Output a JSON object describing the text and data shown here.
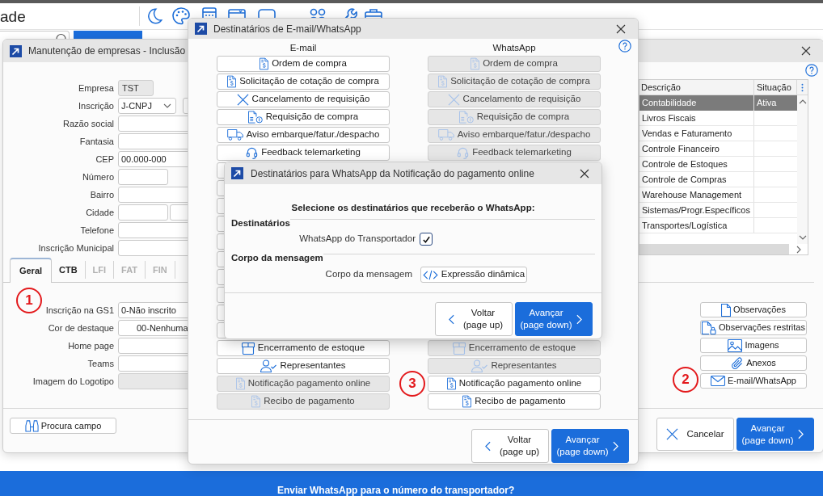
{
  "app": {
    "title": "ade",
    "notification": "Enviar WhatsApp para o número do transportador?"
  },
  "company_window": {
    "title": "Manutenção de empresas - Inclusão",
    "fields": [
      {
        "label": "Empresa",
        "kind": "readonly",
        "value": "TST"
      },
      {
        "label": "Inscrição",
        "kind": "select_pair",
        "value": "J-CNPJ"
      },
      {
        "label": "Razão social",
        "kind": "text"
      },
      {
        "label": "Fantasia",
        "kind": "text"
      },
      {
        "label": "CEP",
        "kind": "text",
        "value": "00.000-000"
      },
      {
        "label": "Número",
        "kind": "short"
      },
      {
        "label": "Bairro",
        "kind": "text"
      },
      {
        "label": "Cidade",
        "kind": "pair"
      },
      {
        "label": "Telefone",
        "kind": "text"
      },
      {
        "label": "Inscrição Municipal",
        "kind": "text"
      }
    ],
    "tabs": [
      {
        "label": "Geral",
        "selected": true,
        "disabled": false
      },
      {
        "label": "CTB",
        "selected": false,
        "disabled": false
      },
      {
        "label": "LFI",
        "selected": false,
        "disabled": true
      },
      {
        "label": "FAT",
        "selected": false,
        "disabled": true
      },
      {
        "label": "FIN",
        "selected": false,
        "disabled": true
      }
    ],
    "tab_annotation": "1",
    "tab_fields": [
      {
        "label": "Inscrição na GS1",
        "kind": "text",
        "value": "0-Não inscrito"
      },
      {
        "label": "Cor de destaque",
        "kind": "color",
        "value": "00-Nenhuma"
      },
      {
        "label": "Home page",
        "kind": "text"
      },
      {
        "label": "Teams",
        "kind": "text"
      },
      {
        "label": "Imagem do Logotipo",
        "kind": "readonly_wide"
      }
    ],
    "search_button": "Procura campo",
    "modules_table": {
      "columns": [
        "Descrição",
        "Situação"
      ],
      "rows": [
        {
          "cells": [
            "Contabilidade",
            "Ativa"
          ],
          "selected": true
        },
        {
          "cells": [
            "Livros Fiscais"
          ],
          "selected": false
        },
        {
          "cells": [
            "Vendas e Faturamento"
          ],
          "selected": false
        },
        {
          "cells": [
            "Controle Financeiro"
          ],
          "selected": false
        },
        {
          "cells": [
            "Controle de Estoques"
          ],
          "selected": false
        },
        {
          "cells": [
            "Controle de Compras"
          ],
          "selected": false
        },
        {
          "cells": [
            "Warehouse Management"
          ],
          "selected": false
        },
        {
          "cells": [
            "Sistemas/Progr.Específicos"
          ],
          "selected": false
        },
        {
          "cells": [
            "Transportes/Logística"
          ],
          "selected": false
        }
      ]
    },
    "side_buttons": [
      {
        "kind": "notes",
        "label": "Observações"
      },
      {
        "kind": "restricted_notes",
        "label": "Observações restritas"
      },
      {
        "kind": "images",
        "label": "Imagens"
      },
      {
        "kind": "attachments",
        "label": "Anexos"
      },
      {
        "kind": "email",
        "label": "E-mail/WhatsApp"
      }
    ],
    "side_annotation": "2",
    "cancel_button": "Cancelar",
    "next_button": {
      "label": "Avançar",
      "hint": "(page down)"
    }
  },
  "recipients_dialog": {
    "title": "Destinatários de E-mail/WhatsApp",
    "columns": [
      "E-mail",
      "WhatsApp"
    ],
    "rows_above": [
      {
        "kind": "doc_dollar",
        "email": {
          "label": "Ordem de compra",
          "disabled": false
        },
        "whatsapp": {
          "label": "Ordem de compra",
          "disabled": true
        }
      },
      {
        "kind": "doc_dollar",
        "email": {
          "label": "Solicitação de cotação de compra",
          "disabled": false
        },
        "whatsapp": {
          "label": "Solicitação de cotação de compra",
          "disabled": true
        }
      },
      {
        "kind": "cancel",
        "email": {
          "label": "Cancelamento de requisição",
          "disabled": false
        },
        "whatsapp": {
          "label": "Cancelamento de requisição",
          "disabled": true
        }
      },
      {
        "kind": "doc_coin",
        "email": {
          "label": "Requisição de compra",
          "disabled": false
        },
        "whatsapp": {
          "label": "Requisição de compra",
          "disabled": true
        }
      },
      {
        "kind": "truck",
        "email": {
          "label": "Aviso embarque/fatur./despacho",
          "disabled": false
        },
        "whatsapp": {
          "label": "Aviso embarque/fatur./despacho",
          "disabled": true
        }
      },
      {
        "kind": "headset",
        "email": {
          "label": "Feedback telemarketing",
          "disabled": false
        },
        "whatsapp": {
          "label": "Feedback telemarketing",
          "disabled": true
        }
      }
    ],
    "rows_below": [
      {
        "kind": "box",
        "email": {
          "label": "Encerramento de estoque",
          "disabled": false
        },
        "whatsapp": {
          "label": "Encerramento de estoque",
          "disabled": true
        }
      },
      {
        "kind": "person",
        "email": {
          "label": "Representantes",
          "disabled": false
        },
        "whatsapp": {
          "label": "Representantes",
          "disabled": true
        }
      },
      {
        "kind": "doc_dollar",
        "email": {
          "label": "Notificação pagamento online",
          "disabled": true
        },
        "whatsapp": {
          "label": "Notificação pagamento online",
          "disabled": false
        }
      },
      {
        "kind": "doc_dollar",
        "email": {
          "label": "Recibo de pagamento",
          "disabled": true
        },
        "whatsapp": {
          "label": "Recibo de pagamento",
          "disabled": false
        }
      }
    ],
    "annotation": "3",
    "back_button": {
      "label": "Voltar",
      "hint": "(page up)"
    },
    "next_button": {
      "label": "Avançar",
      "hint": "(page down)"
    }
  },
  "whatsapp_dialog": {
    "title": "Destinatários para WhatsApp da Notificação do pagamento online",
    "prompt": "Selecione os destinatários que receberão o WhatsApp:",
    "sections": [
      {
        "title": "Destinatários",
        "items": [
          {
            "kind": "checkbox",
            "label": "WhatsApp do Transportador",
            "checked": true
          }
        ]
      },
      {
        "title": "Corpo da mensagem",
        "items": [
          {
            "kind": "button",
            "label": "Corpo da mensagem",
            "button": "Expressão dinâmica"
          }
        ]
      }
    ],
    "back_button": {
      "label": "Voltar",
      "hint": "(page up)"
    },
    "next_button": {
      "label": "Avançar",
      "hint": "(page down)"
    }
  }
}
